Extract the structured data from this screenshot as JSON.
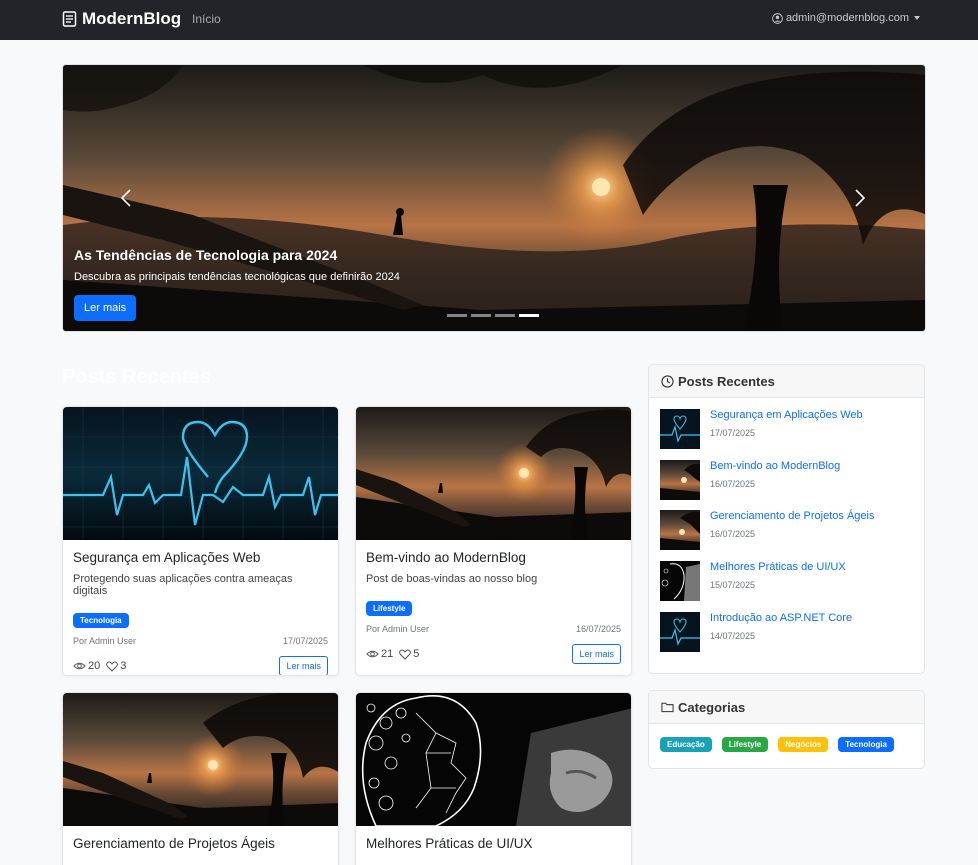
{
  "nav": {
    "brand": "ModernBlog",
    "home": "Início",
    "user": "admin@modernblog.com"
  },
  "carousel": {
    "title": "As Tendências de Tecnologia para 2024",
    "description": "Descubra as principais tendências tecnológicas que definirão 2024",
    "button": "Ler mais",
    "slide_count": 4,
    "active_slide": 4
  },
  "section_title": "Posts Recentes",
  "posts": [
    {
      "title": "Segurança em Aplicações Web",
      "subtitle": "Protegendo suas aplicações contra ameaças digitais",
      "category": "Tecnologia",
      "author": "Por Admin User",
      "date": "17/07/2025",
      "views": "20",
      "likes": "3",
      "button": "Ler mais"
    },
    {
      "title": "Bem-vindo ao ModernBlog",
      "subtitle": "Post de boas-vindas ao nosso blog",
      "category": "Lifestyle",
      "author": "Por Admin User",
      "date": "16/07/2025",
      "views": "21",
      "likes": "5",
      "button": "Ler mais"
    },
    {
      "title": "Gerenciamento de Projetos Ágeis"
    },
    {
      "title": "Melhores Práticas de UI/UX"
    }
  ],
  "sidebar": {
    "recent_title": "Posts Recentes",
    "recent": [
      {
        "title": "Segurança em Aplicações Web",
        "date": "17/07/2025"
      },
      {
        "title": "Bem-vindo ao ModernBlog",
        "date": "16/07/2025"
      },
      {
        "title": "Gerenciamento de Projetos Ágeis",
        "date": "16/07/2025"
      },
      {
        "title": "Melhores Práticas de UI/UX",
        "date": "15/07/2025"
      },
      {
        "title": "Introdução ao ASP.NET Core",
        "date": "14/07/2025"
      }
    ],
    "categories_title": "Categorias",
    "categories": [
      {
        "label": "Educação",
        "color": "#17a2b8"
      },
      {
        "label": "Lifestyle",
        "color": "#28a745"
      },
      {
        "label": "Negócios",
        "color": "#ffc107"
      },
      {
        "label": "Tecnologia",
        "color": "#0d6efd"
      }
    ]
  },
  "colors": {
    "tecnologia": "#0d6efd",
    "lifestyle": "#0d6efd",
    "primary": "#0d6efd",
    "navbar": "#212529"
  }
}
